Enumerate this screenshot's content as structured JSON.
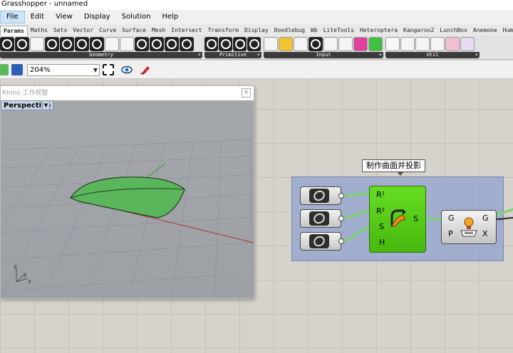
{
  "window": {
    "title": "Grasshopper - unnamed"
  },
  "menu": [
    "File",
    "Edit",
    "View",
    "Display",
    "Solution",
    "Help"
  ],
  "tabs": [
    "Params",
    "Maths",
    "Sets",
    "Vector",
    "Curve",
    "Surface",
    "Mesh",
    "Intersect",
    "Transform",
    "Display",
    "Doodlebug",
    "Wb",
    "LiteTools",
    "Heteroptera",
    "Kangaroo2",
    "LunchBox",
    "Anemone",
    "Human"
  ],
  "ribbon_groups": [
    "Geometry",
    "Primitive",
    "Input",
    "Util"
  ],
  "canvas_toolbar": {
    "zoom": "204%"
  },
  "rhino": {
    "title": "Rhino 工作视窗",
    "close": "×",
    "viewport_label": "Perspective",
    "viewport_arrow": "▼",
    "axes": {
      "z": "z",
      "y": "y",
      "x": "x"
    }
  },
  "gh": {
    "group_name": "制作曲面并投影",
    "main_component": {
      "inputs": [
        "R¹",
        "R²",
        "S",
        "H"
      ],
      "output": "S"
    },
    "project_component": {
      "inputs": [
        "G",
        "P"
      ],
      "outputs": [
        "G",
        "X"
      ]
    }
  },
  "colors": {
    "component_green": "#55cc14",
    "group_fill": "#99a7ce",
    "wire_green": "#7bd46a"
  }
}
